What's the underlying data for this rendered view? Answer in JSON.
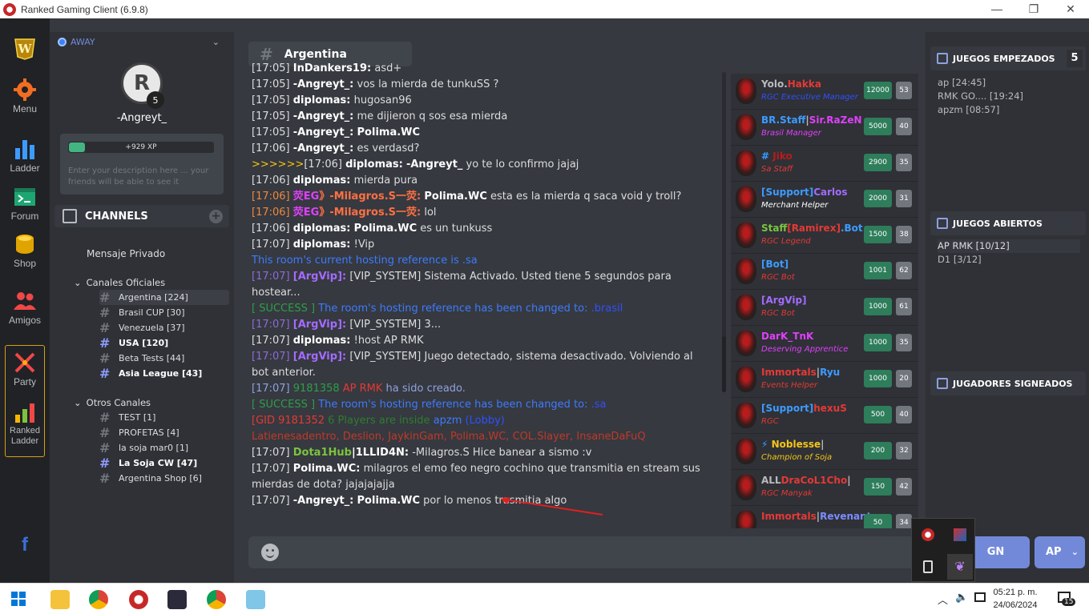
{
  "window": {
    "title": "Ranked Gaming Client (6.9.8)"
  },
  "leftbar": {
    "menu": "Menu",
    "ladder": "Ladder",
    "forum": "Forum",
    "shop": "Shop",
    "amigos": "Amigos",
    "party": "Party",
    "ranked_ladder": "Ranked Ladder"
  },
  "profile": {
    "status": "AWAY",
    "level": "5",
    "username": "-Angreyt_",
    "xp": "+929 XP",
    "xp_progress": 0.11,
    "description_placeholder": "Enter your description here ... your friends will be able to see it"
  },
  "channels": {
    "header": "CHANNELS",
    "private": "Mensaje Privado",
    "official_label": "Canales Oficiales",
    "official": [
      {
        "label": "Argentina [224]",
        "selected": true,
        "bold": false
      },
      {
        "label": "Brasil CUP [30]",
        "selected": false,
        "bold": false
      },
      {
        "label": "Venezuela [37]",
        "selected": false,
        "bold": false
      },
      {
        "label": "USA [120]",
        "selected": false,
        "bold": true
      },
      {
        "label": "Beta Tests [44]",
        "selected": false,
        "bold": false
      },
      {
        "label": "Asia League [43]",
        "selected": false,
        "bold": true
      }
    ],
    "other_label": "Otros Canales",
    "other": [
      {
        "label": "TEST [1]",
        "bold": false
      },
      {
        "label": "PROFETAS [4]",
        "bold": false
      },
      {
        "label": "la soja mar0 [1]",
        "bold": false
      },
      {
        "label": "La Soja CW [47]",
        "bold": true
      },
      {
        "label": "Argentina Shop [6]",
        "bold": false
      }
    ]
  },
  "chat": {
    "title": "Argentina",
    "messages": [
      {
        "parts": [
          {
            "t": "[17:05] ",
            "c": "#dcddde"
          },
          {
            "t": "InDankers19:",
            "c": "#ffffff",
            "b": true
          },
          {
            "t": " asd+",
            "c": "#dcddde"
          }
        ]
      },
      {
        "parts": [
          {
            "t": "[17:05] ",
            "c": "#dcddde"
          },
          {
            "t": "-Angreyt_:",
            "c": "#ffffff",
            "b": true
          },
          {
            "t": " vos la mierda de tunkuSS ?",
            "c": "#dcddde"
          }
        ]
      },
      {
        "parts": [
          {
            "t": "[17:05] ",
            "c": "#dcddde"
          },
          {
            "t": "diplomas:",
            "c": "#ffffff",
            "b": true
          },
          {
            "t": " hugosan96",
            "c": "#dcddde"
          }
        ]
      },
      {
        "parts": [
          {
            "t": "[17:05] ",
            "c": "#dcddde"
          },
          {
            "t": "-Angreyt_:",
            "c": "#ffffff",
            "b": true
          },
          {
            "t": " me dijieron q sos esa mierda",
            "c": "#dcddde"
          }
        ]
      },
      {
        "parts": [
          {
            "t": "[17:05] ",
            "c": "#dcddde"
          },
          {
            "t": "-Angreyt_:",
            "c": "#ffffff",
            "b": true
          },
          {
            "t": " ",
            "c": "#dcddde"
          },
          {
            "t": "Polima.WC",
            "c": "#ffffff",
            "b": true
          }
        ]
      },
      {
        "parts": [
          {
            "t": "[17:06] ",
            "c": "#dcddde"
          },
          {
            "t": "-Angreyt_:",
            "c": "#ffffff",
            "b": true
          },
          {
            "t": " es verdasd?",
            "c": "#dcddde"
          }
        ]
      },
      {
        "parts": [
          {
            "t": ">>>>>>",
            "c": "#f5c518"
          },
          {
            "t": "[17:06] ",
            "c": "#dcddde"
          },
          {
            "t": "diplomas:",
            "c": "#ffffff",
            "b": true
          },
          {
            "t": " ",
            "c": "#dcddde"
          },
          {
            "t": "-Angreyt_",
            "c": "#ffffff",
            "b": true
          },
          {
            "t": " yo te lo confirmo jajaj",
            "c": "#dcddde"
          }
        ]
      },
      {
        "parts": [
          {
            "t": "[17:06] ",
            "c": "#dcddde"
          },
          {
            "t": "diplomas:",
            "c": "#ffffff",
            "b": true
          },
          {
            "t": " mierda pura",
            "c": "#dcddde"
          }
        ]
      },
      {
        "parts": [
          {
            "t": "[17:06] ",
            "c": "#f0883e"
          },
          {
            "t": "荧EG",
            "c": "#e040fb",
            "b": true
          },
          {
            "t": "》-Milagros.S一荧:",
            "c": "#ff7043",
            "b": true
          },
          {
            "t": " ",
            "c": "#dcddde"
          },
          {
            "t": "Polima.WC",
            "c": "#ffffff",
            "b": true
          },
          {
            "t": " esta es la mierda q saca void y troll?",
            "c": "#dcddde"
          }
        ]
      },
      {
        "parts": [
          {
            "t": "[17:06] ",
            "c": "#f0883e"
          },
          {
            "t": "荧EG",
            "c": "#e040fb",
            "b": true
          },
          {
            "t": "》-Milagros.S一荧:",
            "c": "#ff7043",
            "b": true
          },
          {
            "t": " lol",
            "c": "#dcddde"
          }
        ]
      },
      {
        "parts": [
          {
            "t": "[17:06] ",
            "c": "#dcddde"
          },
          {
            "t": "diplomas:",
            "c": "#ffffff",
            "b": true
          },
          {
            "t": " ",
            "c": "#dcddde"
          },
          {
            "t": "Polima.WC",
            "c": "#ffffff",
            "b": true
          },
          {
            "t": " es un tunkuss",
            "c": "#dcddde"
          }
        ]
      },
      {
        "parts": [
          {
            "t": "[17:07] ",
            "c": "#dcddde"
          },
          {
            "t": "diplomas:",
            "c": "#ffffff",
            "b": true
          },
          {
            "t": " !Vip",
            "c": "#dcddde"
          }
        ]
      },
      {
        "parts": [
          {
            "t": "This room's current hosting reference is ",
            "c": "#3d7bff"
          },
          {
            "t": ".sa",
            "c": "#3d7bff"
          }
        ]
      },
      {
        "parts": [
          {
            "t": "[17:07] ",
            "c": "#8e6bd8"
          },
          {
            "t": "[ArgVip]:",
            "c": "#a36bff",
            "b": true
          },
          {
            "t": " [VIP_SYSTEM] Sistema Activado. Usted tiene 5 segundos para hostear...",
            "c": "#dcddde"
          }
        ]
      },
      {
        "parts": [
          {
            "t": "[ SUCCESS ] ",
            "c": "#2e9e4a"
          },
          {
            "t": "The room's hosting reference has been changed to: ",
            "c": "#3d7bff"
          },
          {
            "t": ".brasil",
            "c": "#3050ff"
          }
        ]
      },
      {
        "parts": [
          {
            "t": "[17:07] ",
            "c": "#8e6bd8"
          },
          {
            "t": "[ArgVip]:",
            "c": "#a36bff",
            "b": true
          },
          {
            "t": " [VIP_SYSTEM] 3...",
            "c": "#dcddde"
          }
        ]
      },
      {
        "parts": [
          {
            "t": "[17:07] ",
            "c": "#dcddde"
          },
          {
            "t": "diplomas:",
            "c": "#ffffff",
            "b": true
          },
          {
            "t": " !host AP RMK",
            "c": "#dcddde"
          }
        ]
      },
      {
        "parts": [
          {
            "t": "[17:07] ",
            "c": "#8e6bd8"
          },
          {
            "t": "[ArgVip]:",
            "c": "#a36bff",
            "b": true
          },
          {
            "t": " [VIP_SYSTEM] Juego detectado, sistema desactivado. Volviendo al bot anterior.",
            "c": "#dcddde"
          }
        ]
      },
      {
        "parts": [
          {
            "t": "[17:07] ",
            "c": "#8ea1e1"
          },
          {
            "t": "9181358 ",
            "c": "#2e9e4a"
          },
          {
            "t": "AP RMK",
            "c": "#e53935"
          },
          {
            "t": " ha sido creado.",
            "c": "#8ea1e1"
          }
        ]
      },
      {
        "parts": [
          {
            "t": "[ SUCCESS ] ",
            "c": "#2e9e4a"
          },
          {
            "t": "The room's hosting reference has been changed to: ",
            "c": "#3d7bff"
          },
          {
            "t": ".sa",
            "c": "#3050ff"
          }
        ]
      },
      {
        "parts": [
          {
            "t": "[GID 9181352 ",
            "c": "#e53935"
          },
          {
            "t": "6 Players are inside ",
            "c": "#2e7d32"
          },
          {
            "t": "apzm ",
            "c": "#3d7bff"
          },
          {
            "t": "(Lobby)",
            "c": "#3050ff"
          }
        ]
      },
      {
        "parts": [
          {
            "t": "Latienesadentro, Deslion, JaykinGam, Polima.WC, COL.Slayer, InsaneDaFuQ",
            "c": "#c0392b"
          }
        ]
      },
      {
        "parts": [
          {
            "t": "[17:07] ",
            "c": "#dcddde"
          },
          {
            "t": "Dota1Hub",
            "c": "#7cc340",
            "b": true
          },
          {
            "t": "|1LLID4N:",
            "c": "#ffffff",
            "b": true
          },
          {
            "t": " -Milagros.S Hice banear a sismo :v",
            "c": "#dcddde"
          }
        ]
      },
      {
        "parts": [
          {
            "t": "[17:07] ",
            "c": "#dcddde"
          },
          {
            "t": "Polima.WC:",
            "c": "#ffffff",
            "b": true
          },
          {
            "t": " milagros el emo feo negro cochino que transmitia en stream sus mierdas de dota? jajajajajja",
            "c": "#dcddde"
          }
        ]
      },
      {
        "parts": [
          {
            "t": "[17:07] ",
            "c": "#dcddde"
          },
          {
            "t": "-Angreyt_:",
            "c": "#ffffff",
            "b": true
          },
          {
            "t": " ",
            "c": "#dcddde"
          },
          {
            "t": "Polima.WC",
            "c": "#ffffff",
            "b": true
          },
          {
            "t": " por lo menos trasmitia algo",
            "c": "#dcddde"
          }
        ]
      }
    ]
  },
  "users": [
    {
      "parts": [
        {
          "t": "Yolo.",
          "c": "#b9bbbe"
        },
        {
          "t": "Hakka",
          "c": "#e53935"
        }
      ],
      "title": "RGC Executive Manager",
      "title_color": "#3050ff",
      "points": "12000",
      "level": "53"
    },
    {
      "parts": [
        {
          "t": "BR.Staff",
          "c": "#3d9bff"
        },
        {
          "t": "|",
          "c": "#b9bbbe"
        },
        {
          "t": "Sir.RaZeN",
          "c": "#e040fb"
        }
      ],
      "title": "Brasil Manager",
      "title_color": "#e040fb",
      "points": "5000",
      "level": "40"
    },
    {
      "parts": [
        {
          "t": "# ",
          "c": "#3d9bff"
        },
        {
          "t": "Jiko",
          "c": "#b71c1c"
        }
      ],
      "title": "Sa Staff",
      "title_color": "#e53935",
      "points": "2900",
      "level": "35"
    },
    {
      "parts": [
        {
          "t": "[Support]",
          "c": "#3d9bff"
        },
        {
          "t": "Carlos",
          "c": "#a36bff"
        }
      ],
      "title": "Merchant Helper",
      "title_color": "#ffffff",
      "points": "2000",
      "level": "31"
    },
    {
      "parts": [
        {
          "t": "Staff",
          "c": "#7cc340"
        },
        {
          "t": "[",
          "c": "#e53935"
        },
        {
          "t": "Ramirex",
          "c": "#e53935"
        },
        {
          "t": "]",
          "c": "#e53935"
        },
        {
          "t": ".Bot",
          "c": "#3d9bff"
        }
      ],
      "title": "RGC Legend",
      "title_color": "#e53935",
      "points": "1500",
      "level": "38"
    },
    {
      "parts": [
        {
          "t": "[Bot]",
          "c": "#3d9bff"
        }
      ],
      "title": "RGC Bot",
      "title_color": "#e53935",
      "points": "1001",
      "level": "62"
    },
    {
      "parts": [
        {
          "t": "[ArgVip]",
          "c": "#a36bff"
        }
      ],
      "title": "RGC Bot",
      "title_color": "#e53935",
      "points": "1000",
      "level": "61"
    },
    {
      "parts": [
        {
          "t": "DarK_TnK",
          "c": "#e040fb"
        }
      ],
      "title": "Deserving Apprentice",
      "title_color": "#e040fb",
      "points": "1000",
      "level": "35"
    },
    {
      "parts": [
        {
          "t": "Immortals",
          "c": "#e53935"
        },
        {
          "t": "|",
          "c": "#b9bbbe"
        },
        {
          "t": "Ryu",
          "c": "#3d9bff"
        }
      ],
      "title": "Events Helper",
      "title_color": "#e53935",
      "points": "1000",
      "level": "20"
    },
    {
      "parts": [
        {
          "t": "[Support]",
          "c": "#3d9bff"
        },
        {
          "t": "hexuS",
          "c": "#e53935"
        }
      ],
      "title": "RGC",
      "title_color": "#e53935",
      "points": "500",
      "level": "40"
    },
    {
      "parts": [
        {
          "t": "⚡ ",
          "c": "#3d9bff"
        },
        {
          "t": "Noblesse",
          "c": "#f5c518"
        },
        {
          "t": "|",
          "c": "#b9bbbe"
        }
      ],
      "title": "Champion of Soja",
      "title_color": "#f5c518",
      "points": "200",
      "level": "32"
    },
    {
      "parts": [
        {
          "t": "ALL",
          "c": "#b9bbbe"
        },
        {
          "t": "DraCoL1Cho",
          "c": "#e53935"
        },
        {
          "t": "|",
          "c": "#b9bbbe"
        }
      ],
      "title": "RGC Manyak",
      "title_color": "#e53935",
      "points": "150",
      "level": "42"
    },
    {
      "parts": [
        {
          "t": "Immortals",
          "c": "#e53935"
        },
        {
          "t": "|",
          "c": "#b9bbbe"
        },
        {
          "t": "Revenant",
          "c": "#7b8cff"
        }
      ],
      "title": "",
      "title_color": "#e53935",
      "points": "50",
      "level": "34"
    }
  ],
  "right": {
    "started_label": "JUEGOS EMPEZADOS",
    "started_count": "5",
    "started": [
      "ap [24:45]",
      "RMK GO.... [19:24]",
      "apzm [08:57]"
    ],
    "open_label": "JUEGOS ABIERTOS",
    "open": [
      "AP RMK [10/12]",
      "D1 [3/12]"
    ],
    "signed_label": "JUGADORES SIGNEADOS"
  },
  "buttons": {
    "ign": "GN",
    "ap": "AP"
  },
  "taskbar": {
    "time": "05:21 p. m.",
    "date": "24/06/2024",
    "notifications": "15"
  }
}
